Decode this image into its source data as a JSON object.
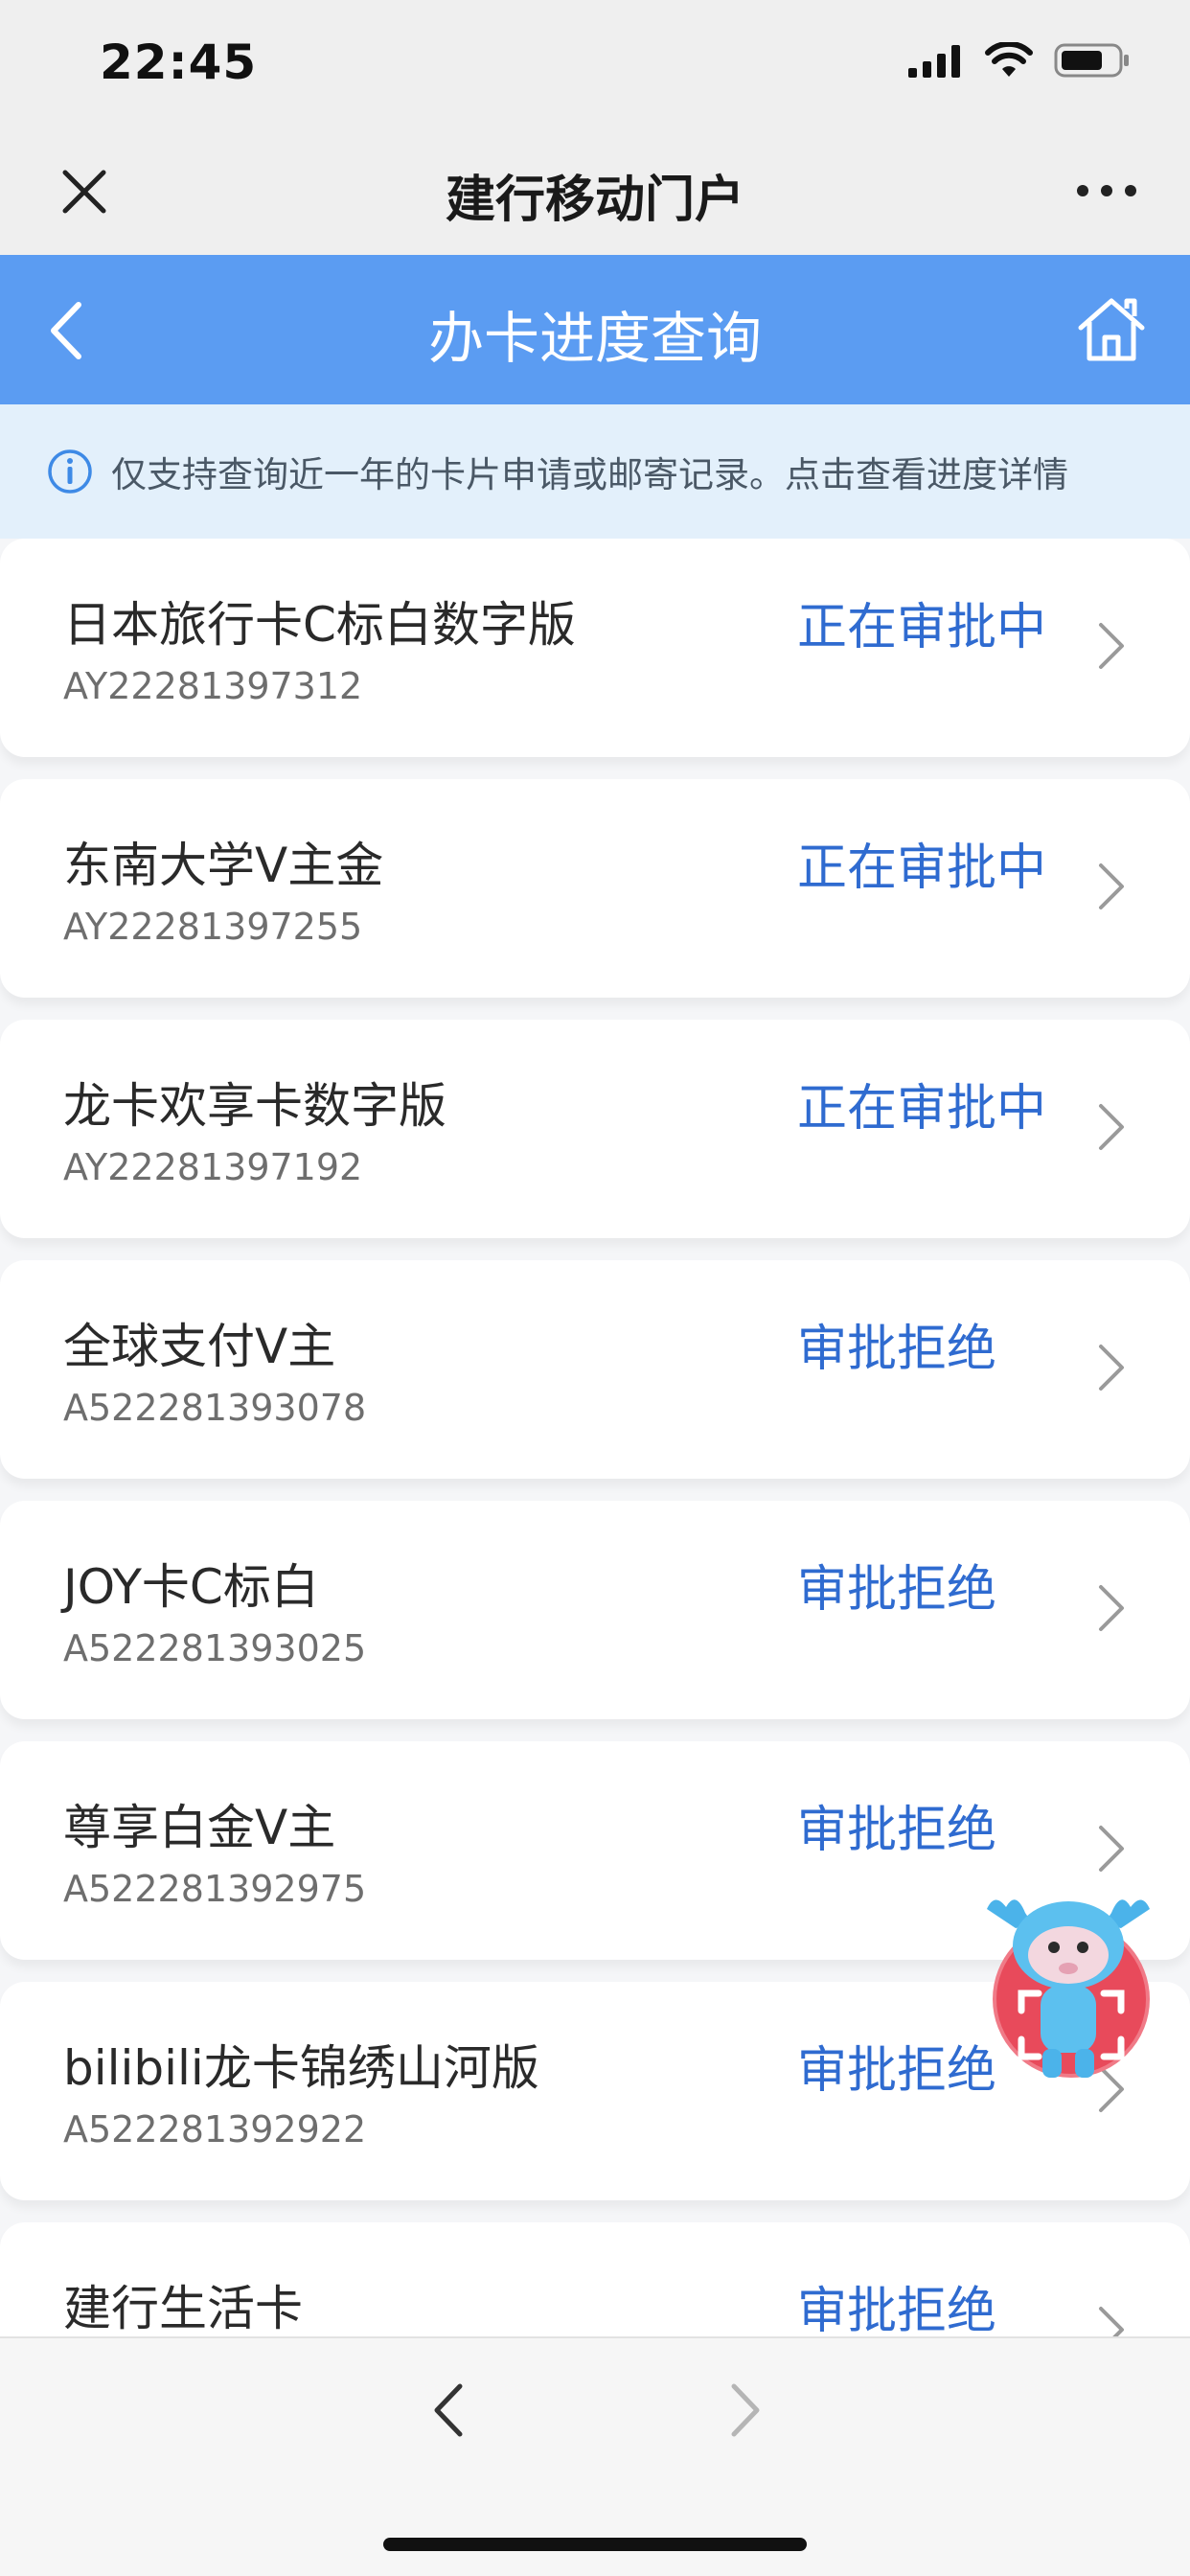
{
  "status_bar": {
    "time": "22:45"
  },
  "wechat_bar": {
    "title": "建行移动门户"
  },
  "app_header": {
    "title": "办卡进度查询"
  },
  "notice": {
    "text": "仅支持查询近一年的卡片申请或邮寄记录。点击查看进度详情"
  },
  "cards": [
    {
      "name": "日本旅行卡C标白数字版",
      "id": "AY22281397312",
      "status": "正在审批中"
    },
    {
      "name": "东南大学V主金",
      "id": "AY22281397255",
      "status": "正在审批中"
    },
    {
      "name": "龙卡欢享卡数字版",
      "id": "AY22281397192",
      "status": "正在审批中"
    },
    {
      "name": "全球支付V主",
      "id": "A522281393078",
      "status": "审批拒绝"
    },
    {
      "name": "JOY卡C标白",
      "id": "A522281393025",
      "status": "审批拒绝"
    },
    {
      "name": "尊享白金V主",
      "id": "A522281392975",
      "status": "审批拒绝"
    },
    {
      "name": "bilibili龙卡锦绣山河版",
      "id": "A522281392922",
      "status": "审批拒绝"
    },
    {
      "name": "建行生活卡",
      "id": "",
      "status": "审批拒绝"
    }
  ],
  "colors": {
    "header_blue": "#5b9cf2",
    "status_blue": "#2f6bd0",
    "notice_bg": "#e3f0fb",
    "mascot_red": "#e84a5b"
  },
  "icons": {
    "close": "close-icon",
    "more": "more-icon",
    "back": "back-arrow-icon",
    "home": "home-icon",
    "info": "info-icon",
    "chevron": "chevron-right-icon",
    "mascot": "mascot-scan-icon",
    "nav_back": "nav-back-icon",
    "nav_forward": "nav-forward-icon"
  }
}
